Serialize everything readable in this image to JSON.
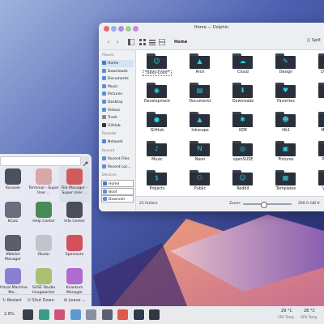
{
  "window": {
    "title": "Home — Dolphin"
  },
  "toolbar": {
    "breadcrumb": "Home",
    "split_label": "Split",
    "back": "‹",
    "forward": "›"
  },
  "sidebar": {
    "places_header": "Places",
    "places": [
      "Home",
      "Downloads",
      "Documents",
      "Music",
      "Pictures",
      "Desktop",
      "Videos",
      "Trash",
      "GitHub"
    ],
    "remote_header": "Remote",
    "remote": [
      "Network"
    ],
    "recent_header": "Recent",
    "recent": [
      "Recent Files",
      "Recent Loc..."
    ],
    "devices_header": "Devices",
    "devices": [
      "Home",
      "Boot",
      "Downroll"
    ]
  },
  "folders": [
    {
      "name": "\"Dexy-Color\"",
      "glyph": "☺"
    },
    {
      "name": "Arch",
      "glyph": "▲"
    },
    {
      "name": "Cloud",
      "glyph": "☁"
    },
    {
      "name": "Design",
      "glyph": "✎"
    },
    {
      "name": "Desktop",
      "glyph": "▭"
    },
    {
      "name": "Development",
      "glyph": "◉"
    },
    {
      "name": "Documents",
      "glyph": "▤"
    },
    {
      "name": "Downloads",
      "glyph": "⬇"
    },
    {
      "name": "Favorites",
      "glyph": "♥"
    },
    {
      "name": "Gimp",
      "glyph": "✿"
    },
    {
      "name": "GitHub",
      "glyph": "●"
    },
    {
      "name": "Inkscape",
      "glyph": "▲"
    },
    {
      "name": "KDE",
      "glyph": "✱"
    },
    {
      "name": "l4k1",
      "glyph": "☻"
    },
    {
      "name": "Manjaro",
      "glyph": "▥"
    },
    {
      "name": "Music",
      "glyph": "♪"
    },
    {
      "name": "Neon",
      "glyph": "N"
    },
    {
      "name": "openSUSE",
      "glyph": "◎"
    },
    {
      "name": "Pictures",
      "glyph": "▣"
    },
    {
      "name": "Plasma",
      "glyph": "✲"
    },
    {
      "name": "Projects",
      "glyph": "$"
    },
    {
      "name": "Public",
      "glyph": "⚇"
    },
    {
      "name": "Reddit",
      "glyph": "☺"
    },
    {
      "name": "Templates",
      "glyph": "▦"
    },
    {
      "name": "Videos",
      "glyph": "▶"
    }
  ],
  "status": {
    "count": "25 folders",
    "zoom_label": "Zoom:",
    "free_space": "269.0 GiB fr"
  },
  "launcher": {
    "apps": [
      {
        "label": "Konsole",
        "color": "#4a5160",
        "icon": "konsole-icon"
      },
      {
        "label": "Terminal - Super User ...",
        "color": "#d8a8a8",
        "icon": "terminal-icon"
      },
      {
        "label": "File Manager - Super User ...",
        "color": "#d05b5b",
        "icon": "file-manager-icon"
      },
      {
        "label": "KCalc",
        "color": "#6a7080",
        "icon": "kcalc-icon"
      },
      {
        "label": "Help Center",
        "color": "#4a8a5a",
        "icon": "help-center-icon"
      },
      {
        "label": "Info Center",
        "color": "#4a4f5c",
        "icon": "info-center-icon"
      },
      {
        "label": "KWallet Manager",
        "color": "#5a5f6b",
        "icon": "kwallet-icon"
      },
      {
        "label": "Okular",
        "color": "#c0c4cc",
        "icon": "okular-icon"
      },
      {
        "label": "Spectacle",
        "color": "#d4505a",
        "icon": "spectacle-icon"
      },
      {
        "label": "Virtual Machine Ma...",
        "color": "#8a7fd0",
        "icon": "virtual-machine-icon"
      },
      {
        "label": "SUSE Studio Imagewriter",
        "color": "#a8c070",
        "icon": "imagewriter-icon"
      },
      {
        "label": "Kvantum Manager",
        "color": "#b06ad0",
        "icon": "kvantum-icon"
      }
    ],
    "restart": "Restart",
    "shutdown": "Shut Down",
    "leave": "Leave"
  },
  "panel": {
    "cpu_load": "2.8%",
    "cpu_temp": "29 °C",
    "cpu_temp_label": "CPU Temp",
    "gpu_temp": "28 °C",
    "gpu_temp_label": "GPU Temp",
    "tasks": [
      {
        "icon": "folder-icon",
        "color": "#38404c"
      },
      {
        "icon": "store-icon",
        "color": "#3a9c8a"
      },
      {
        "icon": "color-icon",
        "color": "#d0547a"
      },
      {
        "icon": "calendar-icon",
        "color": "#5c9ad0"
      },
      {
        "icon": "gamepad-icon",
        "color": "#8a8fa0"
      },
      {
        "icon": "settings-icon",
        "color": "#5a6070"
      },
      {
        "icon": "browser-icon",
        "color": "#e05a4a"
      },
      {
        "icon": "dolphin-icon",
        "color": "#2f3a4a"
      },
      {
        "icon": "konsole-icon",
        "color": "#323640"
      }
    ]
  }
}
